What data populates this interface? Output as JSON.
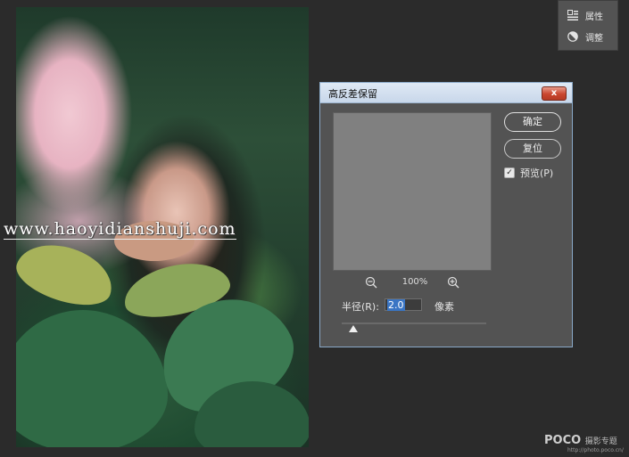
{
  "canvas": {
    "watermark_text": "www.haoyidianshuji.com"
  },
  "side_panel": {
    "items": [
      {
        "label": "属性",
        "icon": "properties-icon"
      },
      {
        "label": "调整",
        "icon": "adjustments-icon"
      }
    ]
  },
  "dialog": {
    "title": "高反差保留",
    "close_label": "x",
    "ok_label": "确定",
    "reset_label": "复位",
    "preview_label": "预览(P)",
    "preview_checked": true,
    "zoom_level": "100%",
    "radius_label": "半径(R):",
    "radius_value": "2.0",
    "radius_unit": "像素"
  },
  "branding": {
    "logo_text": "POCO",
    "logo_sub": "摄影专题",
    "url": "http://photo.poco.cn/"
  },
  "colors": {
    "panel_bg": "#535353",
    "workspace_bg": "#2b2b2b",
    "preview_gray": "#808080",
    "selection_blue": "#3a75c4"
  }
}
